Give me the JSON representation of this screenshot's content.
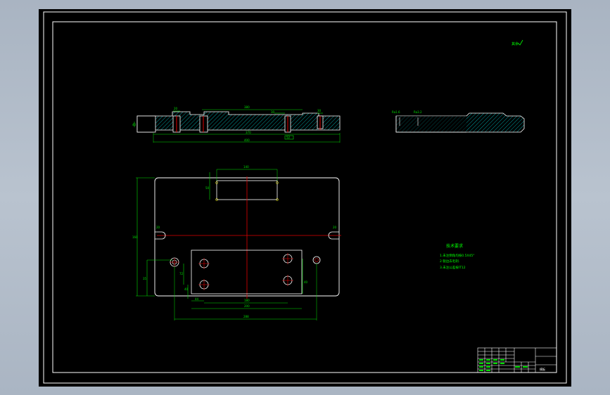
{
  "drawing": {
    "sheet_note": "其余",
    "tech_requirements": {
      "title": "技术要求",
      "items": [
        "1.未注倒角均按0.5X45°",
        "2.锐边去毛刺.",
        "3.未注公差按IT12"
      ]
    },
    "section_dims": {
      "top": "380",
      "a": "20",
      "b": "30",
      "c": "30",
      "d": "52",
      "e": "40",
      "f": "30",
      "inner": "370",
      "overall": "400"
    },
    "side_view_labels": [
      "Ra1.6",
      "Ra3.2"
    ],
    "plan_dims": {
      "slot_w": "140",
      "slot_h": "50",
      "left_height": "160",
      "hole_v": "35",
      "hole_v2": "72",
      "hole_off": "40",
      "bolt_h": "44",
      "span_inner": "180",
      "span_mid": "200",
      "span_outer": "288",
      "right_v": "40",
      "u_slot_l": "20",
      "u_slot_r": "20"
    },
    "title_block": {
      "label": "模板"
    }
  },
  "colors": {
    "outline": "#ffffff",
    "dimension": "#00e000",
    "hatch": "#00c8c8",
    "centerline": "#e00000",
    "frame": "#ffffff",
    "note": "#00ff00"
  }
}
